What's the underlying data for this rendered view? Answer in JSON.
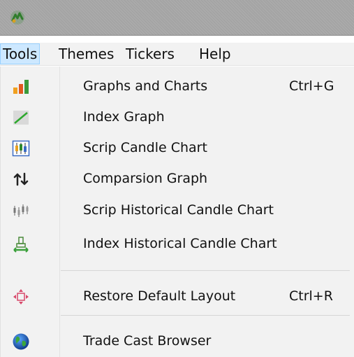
{
  "menubar": {
    "tools": "Tools",
    "themes": "Themes",
    "tickers": "Tickers",
    "help": "Help"
  },
  "tools_menu": {
    "items": [
      {
        "label": "Graphs and Charts",
        "shortcut": "Ctrl+G",
        "icon": "bar-chart-icon"
      },
      {
        "label": "Index Graph",
        "shortcut": "",
        "icon": "line-graph-icon"
      },
      {
        "label": "Scrip Candle Chart",
        "shortcut": "",
        "icon": "candle-chart-icon"
      },
      {
        "label": "Comparsion Graph",
        "shortcut": "",
        "icon": "compare-arrows-icon"
      },
      {
        "label": "Scrip Historical Candle Chart",
        "shortcut": "",
        "icon": "historical-candle-icon"
      },
      {
        "label": "Index Historical Candle Chart",
        "shortcut": "",
        "icon": "index-historical-icon"
      },
      {
        "label": "Restore Default Layout",
        "shortcut": "Ctrl+R",
        "icon": "move-arrows-icon"
      },
      {
        "label": "Trade Cast Browser",
        "shortcut": "",
        "icon": "globe-icon"
      }
    ]
  },
  "colors": {
    "titlebar": "#a4a4a4",
    "menubar_bg": "#f2f2f2",
    "active_menu_bg": "#cde8ff",
    "active_menu_border": "#99d1ff"
  }
}
